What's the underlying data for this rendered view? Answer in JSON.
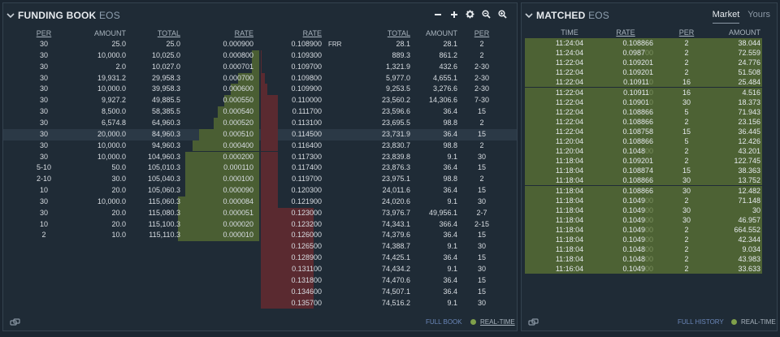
{
  "colors": {
    "bid_bar": "#4a5e33",
    "ask_bar": "#5a2a30",
    "highlight_row": "#2b3946",
    "match_row": "#4d6234"
  },
  "book": {
    "title": "FUNDING BOOK",
    "symbol": "EOS",
    "tools": [
      "minus-icon",
      "plus-icon",
      "gear-icon",
      "zoom-out-icon",
      "zoom-in-icon"
    ],
    "headers": {
      "bid_per": "PER",
      "bid_amount": "AMOUNT",
      "bid_total": "TOTAL",
      "bid_rate": "RATE",
      "ask_rate": "RATE",
      "ask_total": "TOTAL",
      "ask_amount": "AMOUNT",
      "ask_per": "PER"
    },
    "rows": [
      {
        "bid_per": "30",
        "bid_amount": "25.0",
        "bid_total": "25.0",
        "bid_rate": "0.000900",
        "ask_rate": "0.108900",
        "ask_frr": "FRR",
        "ask_total": "28.1",
        "ask_amount": "28.1",
        "ask_per": "2",
        "bid_depth": 0.0,
        "ask_depth": 0.0
      },
      {
        "bid_per": "30",
        "bid_amount": "10,000.0",
        "bid_total": "10,025.0",
        "bid_rate": "0.000800",
        "ask_rate": "0.109300",
        "ask_frr": "",
        "ask_total": "889.3",
        "ask_amount": "861.2",
        "ask_per": "2",
        "bid_depth": 0.087,
        "ask_depth": 0.012
      },
      {
        "bid_per": "30",
        "bid_amount": "2.0",
        "bid_total": "10,027.0",
        "bid_rate": "0.000701",
        "ask_rate": "0.109700",
        "ask_frr": "",
        "ask_total": "1,321.9",
        "ask_amount": "432.6",
        "ask_per": "2-30",
        "bid_depth": 0.087,
        "ask_depth": 0.018
      },
      {
        "bid_per": "30",
        "bid_amount": "19,931.2",
        "bid_total": "29,958.3",
        "bid_rate": "0.000700",
        "ask_rate": "0.109800",
        "ask_frr": "",
        "ask_total": "5,977.0",
        "ask_amount": "4,655.1",
        "ask_per": "2-30",
        "bid_depth": 0.26,
        "ask_depth": 0.08
      },
      {
        "bid_per": "30",
        "bid_amount": "10,000.0",
        "bid_total": "39,958.3",
        "bid_rate": "0.000600",
        "ask_rate": "0.109900",
        "ask_frr": "",
        "ask_total": "9,253.5",
        "ask_amount": "3,276.6",
        "ask_per": "2-30",
        "bid_depth": 0.347,
        "ask_depth": 0.124
      },
      {
        "bid_per": "30",
        "bid_amount": "9,927.2",
        "bid_total": "49,885.5",
        "bid_rate": "0.000550",
        "ask_rate": "0.110000",
        "ask_frr": "",
        "ask_total": "23,560.2",
        "ask_amount": "14,306.6",
        "ask_per": "7-30",
        "bid_depth": 0.433,
        "ask_depth": 0.316
      },
      {
        "bid_per": "30",
        "bid_amount": "8,500.0",
        "bid_total": "58,385.5",
        "bid_rate": "0.000540",
        "ask_rate": "0.111700",
        "ask_frr": "",
        "ask_total": "23,596.6",
        "ask_amount": "36.4",
        "ask_per": "15",
        "bid_depth": 0.507,
        "ask_depth": 0.317
      },
      {
        "bid_per": "30",
        "bid_amount": "6,574.8",
        "bid_total": "64,960.3",
        "bid_rate": "0.000520",
        "ask_rate": "0.113100",
        "ask_frr": "",
        "ask_total": "23,695.5",
        "ask_amount": "98.8",
        "ask_per": "2",
        "bid_depth": 0.564,
        "ask_depth": 0.318
      },
      {
        "bid_per": "30",
        "bid_amount": "20,000.0",
        "bid_total": "84,960.3",
        "bid_rate": "0.000510",
        "ask_rate": "0.114500",
        "ask_frr": "",
        "ask_total": "23,731.9",
        "ask_amount": "36.4",
        "ask_per": "15",
        "bid_depth": 0.738,
        "ask_depth": 0.318
      },
      {
        "bid_per": "30",
        "bid_amount": "10,000.0",
        "bid_total": "94,960.3",
        "bid_rate": "0.000400",
        "ask_rate": "0.116400",
        "ask_frr": "",
        "ask_total": "23,830.7",
        "ask_amount": "98.8",
        "ask_per": "2",
        "bid_depth": 0.825,
        "ask_depth": 0.32
      },
      {
        "bid_per": "30",
        "bid_amount": "10,000.0",
        "bid_total": "104,960.3",
        "bid_rate": "0.000200",
        "ask_rate": "0.117300",
        "ask_frr": "",
        "ask_total": "23,839.8",
        "ask_amount": "9.1",
        "ask_per": "30",
        "bid_depth": 0.912,
        "ask_depth": 0.32
      },
      {
        "bid_per": "5-10",
        "bid_amount": "50.0",
        "bid_total": "105,010.3",
        "bid_rate": "0.000110",
        "ask_rate": "0.117400",
        "ask_frr": "",
        "ask_total": "23,876.3",
        "ask_amount": "36.4",
        "ask_per": "15",
        "bid_depth": 0.912,
        "ask_depth": 0.321
      },
      {
        "bid_per": "2-10",
        "bid_amount": "30.0",
        "bid_total": "105,040.3",
        "bid_rate": "0.000100",
        "ask_rate": "0.119700",
        "ask_frr": "",
        "ask_total": "23,975.1",
        "ask_amount": "98.8",
        "ask_per": "2",
        "bid_depth": 0.913,
        "ask_depth": 0.322
      },
      {
        "bid_per": "10",
        "bid_amount": "20.0",
        "bid_total": "105,060.3",
        "bid_rate": "0.000090",
        "ask_rate": "0.120300",
        "ask_frr": "",
        "ask_total": "24,011.6",
        "ask_amount": "36.4",
        "ask_per": "15",
        "bid_depth": 0.913,
        "ask_depth": 0.323
      },
      {
        "bid_per": "30",
        "bid_amount": "10,000.0",
        "bid_total": "115,060.3",
        "bid_rate": "0.000084",
        "ask_rate": "0.121900",
        "ask_frr": "",
        "ask_total": "24,020.6",
        "ask_amount": "9.1",
        "ask_per": "30",
        "bid_depth": 1.0,
        "ask_depth": 0.323
      },
      {
        "bid_per": "30",
        "bid_amount": "20.0",
        "bid_total": "115,080.3",
        "bid_rate": "0.000051",
        "ask_rate": "0.123000",
        "ask_frr": "",
        "ask_total": "73,976.7",
        "ask_amount": "49,956.1",
        "ask_per": "2-7",
        "bid_depth": 1.0,
        "ask_depth": 0.993
      },
      {
        "bid_per": "10",
        "bid_amount": "20.0",
        "bid_total": "115,100.3",
        "bid_rate": "0.000020",
        "ask_rate": "0.123200",
        "ask_frr": "",
        "ask_total": "74,343.1",
        "ask_amount": "366.4",
        "ask_per": "2-15",
        "bid_depth": 1.0,
        "ask_depth": 0.998
      },
      {
        "bid_per": "2",
        "bid_amount": "10.0",
        "bid_total": "115,110.3",
        "bid_rate": "0.000010",
        "ask_rate": "0.126000",
        "ask_frr": "",
        "ask_total": "74,379.6",
        "ask_amount": "36.4",
        "ask_per": "15",
        "bid_depth": 1.0,
        "ask_depth": 0.998
      },
      {
        "bid_per": "",
        "bid_amount": "",
        "bid_total": "",
        "bid_rate": "",
        "ask_rate": "0.126500",
        "ask_frr": "",
        "ask_total": "74,388.7",
        "ask_amount": "9.1",
        "ask_per": "30",
        "bid_depth": 0,
        "ask_depth": 0.998
      },
      {
        "bid_per": "",
        "bid_amount": "",
        "bid_total": "",
        "bid_rate": "",
        "ask_rate": "0.128900",
        "ask_frr": "",
        "ask_total": "74,425.1",
        "ask_amount": "36.4",
        "ask_per": "15",
        "bid_depth": 0,
        "ask_depth": 0.999
      },
      {
        "bid_per": "",
        "bid_amount": "",
        "bid_total": "",
        "bid_rate": "",
        "ask_rate": "0.131100",
        "ask_frr": "",
        "ask_total": "74,434.2",
        "ask_amount": "9.1",
        "ask_per": "30",
        "bid_depth": 0,
        "ask_depth": 0.999
      },
      {
        "bid_per": "",
        "bid_amount": "",
        "bid_total": "",
        "bid_rate": "",
        "ask_rate": "0.131800",
        "ask_frr": "",
        "ask_total": "74,470.6",
        "ask_amount": "36.4",
        "ask_per": "15",
        "bid_depth": 0,
        "ask_depth": 1.0
      },
      {
        "bid_per": "",
        "bid_amount": "",
        "bid_total": "",
        "bid_rate": "",
        "ask_rate": "0.134600",
        "ask_frr": "",
        "ask_total": "74,507.1",
        "ask_amount": "36.4",
        "ask_per": "15",
        "bid_depth": 0,
        "ask_depth": 1.0
      },
      {
        "bid_per": "",
        "bid_amount": "",
        "bid_total": "",
        "bid_rate": "",
        "ask_rate": "0.135700",
        "ask_frr": "",
        "ask_total": "74,516.2",
        "ask_amount": "9.1",
        "ask_per": "30",
        "bid_depth": 0,
        "ask_depth": 1.0
      }
    ],
    "footer": {
      "full_book": "FULL BOOK",
      "realtime": "REAL-TIME"
    }
  },
  "matched": {
    "title": "MATCHED",
    "symbol": "EOS",
    "tabs": [
      "Market",
      "Yours"
    ],
    "headers": {
      "time": "TIME",
      "rate": "RATE",
      "per": "PER",
      "amount": "AMOUNT"
    },
    "rows": [
      {
        "time": "11:24:04",
        "rate_main": "0.108866",
        "rate_faded": "",
        "per": "2",
        "amount": "38.044"
      },
      {
        "time": "11:24:04",
        "rate_main": "0.0987",
        "rate_faded": "00",
        "per": "2",
        "amount": "72.559"
      },
      {
        "time": "11:22:04",
        "rate_main": "0.109201",
        "rate_faded": "",
        "per": "2",
        "amount": "24.776"
      },
      {
        "time": "11:22:04",
        "rate_main": "0.109201",
        "rate_faded": "",
        "per": "2",
        "amount": "51.508"
      },
      {
        "time": "11:22:04",
        "rate_main": "0.10911",
        "rate_faded": "0",
        "per": "16",
        "amount": "25.484"
      },
      {
        "time": "11:22:04",
        "rate_main": "0.10911",
        "rate_faded": "0",
        "per": "16",
        "amount": "4.516"
      },
      {
        "time": "11:22:04",
        "rate_main": "0.10901",
        "rate_faded": "0",
        "per": "30",
        "amount": "18.373"
      },
      {
        "time": "11:22:04",
        "rate_main": "0.108866",
        "rate_faded": "",
        "per": "5",
        "amount": "71.943"
      },
      {
        "time": "11:22:04",
        "rate_main": "0.108866",
        "rate_faded": "",
        "per": "2",
        "amount": "23.156"
      },
      {
        "time": "11:22:04",
        "rate_main": "0.108758",
        "rate_faded": "",
        "per": "15",
        "amount": "36.445"
      },
      {
        "time": "11:20:04",
        "rate_main": "0.108866",
        "rate_faded": "",
        "per": "5",
        "amount": "12.426"
      },
      {
        "time": "11:20:04",
        "rate_main": "0.1048",
        "rate_faded": "00",
        "per": "2",
        "amount": "43.201"
      },
      {
        "time": "11:18:04",
        "rate_main": "0.109201",
        "rate_faded": "",
        "per": "2",
        "amount": "122.745"
      },
      {
        "time": "11:18:04",
        "rate_main": "0.108874",
        "rate_faded": "",
        "per": "15",
        "amount": "38.363"
      },
      {
        "time": "11:18:04",
        "rate_main": "0.108866",
        "rate_faded": "",
        "per": "30",
        "amount": "13.752"
      },
      {
        "time": "11:18:04",
        "rate_main": "0.108866",
        "rate_faded": "",
        "per": "30",
        "amount": "12.482"
      },
      {
        "time": "11:18:04",
        "rate_main": "0.1049",
        "rate_faded": "00",
        "per": "2",
        "amount": "71.148"
      },
      {
        "time": "11:18:04",
        "rate_main": "0.1049",
        "rate_faded": "00",
        "per": "30",
        "amount": "30"
      },
      {
        "time": "11:18:04",
        "rate_main": "0.1049",
        "rate_faded": "00",
        "per": "30",
        "amount": "46.957"
      },
      {
        "time": "11:18:04",
        "rate_main": "0.1049",
        "rate_faded": "00",
        "per": "2",
        "amount": "664.552"
      },
      {
        "time": "11:18:04",
        "rate_main": "0.1049",
        "rate_faded": "00",
        "per": "2",
        "amount": "42.344"
      },
      {
        "time": "11:18:04",
        "rate_main": "0.1048",
        "rate_faded": "00",
        "per": "2",
        "amount": "9.034"
      },
      {
        "time": "11:18:04",
        "rate_main": "0.1048",
        "rate_faded": "00",
        "per": "2",
        "amount": "43.983"
      },
      {
        "time": "11:16:04",
        "rate_main": "0.1049",
        "rate_faded": "00",
        "per": "2",
        "amount": "33.633"
      }
    ],
    "footer": {
      "full_history": "FULL HISTORY",
      "realtime": "REAL-TIME"
    }
  }
}
